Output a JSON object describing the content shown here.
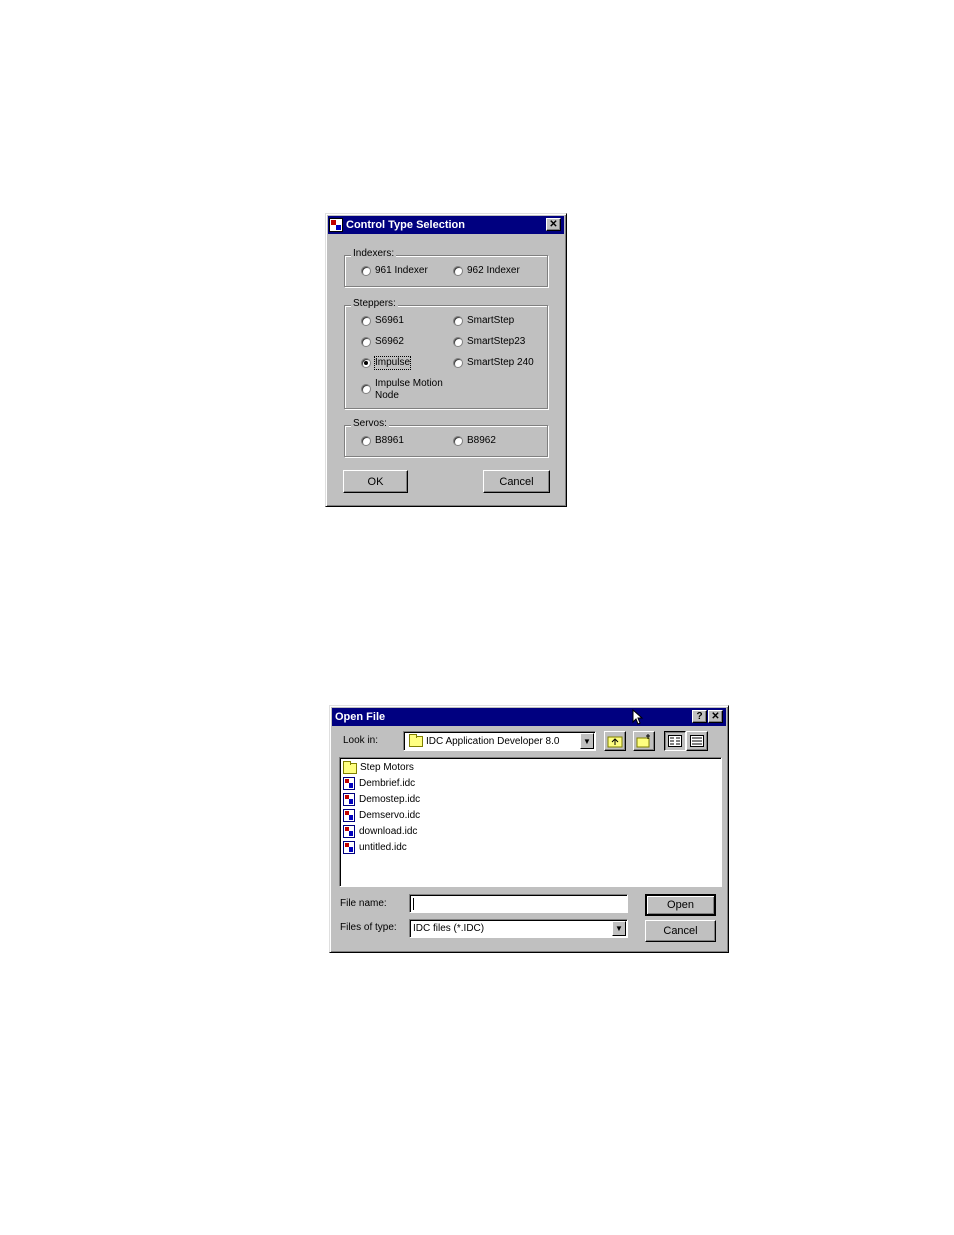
{
  "control_dialog": {
    "title": "Control Type Selection",
    "close_glyph": "✕",
    "groups": {
      "indexers": {
        "label": "Indexers:",
        "options": [
          "961 Indexer",
          "962 Indexer"
        ]
      },
      "steppers": {
        "label": "Steppers:",
        "options": [
          "S6961",
          "SmartStep",
          "S6962",
          "SmartStep23",
          "Impulse",
          "SmartStep 240",
          "Impulse Motion Node"
        ]
      },
      "servos": {
        "label": "Servos:",
        "options": [
          "B8961",
          "B8962"
        ]
      }
    },
    "selected": "Impulse",
    "ok_label": "OK",
    "cancel_label": "Cancel"
  },
  "open_dialog": {
    "title": "Open File",
    "help_glyph": "?",
    "close_glyph": "✕",
    "look_in_label": "Look in:",
    "look_in_value": "IDC Application Developer 8.0",
    "files": [
      {
        "name": "Step Motors",
        "icon": "folder-icon"
      },
      {
        "name": "Dembrief.idc",
        "icon": "idc-file-icon"
      },
      {
        "name": "Demostep.idc",
        "icon": "idc-file-icon"
      },
      {
        "name": "Demservo.idc",
        "icon": "idc-file-icon"
      },
      {
        "name": "download.idc",
        "icon": "idc-file-icon"
      },
      {
        "name": "untitled.idc",
        "icon": "idc-file-icon"
      }
    ],
    "file_name_label": "File name:",
    "file_name_value": "",
    "files_of_type_label": "Files of type:",
    "files_of_type_value": "IDC files (*.IDC)",
    "open_label": "Open",
    "cancel_label": "Cancel"
  }
}
